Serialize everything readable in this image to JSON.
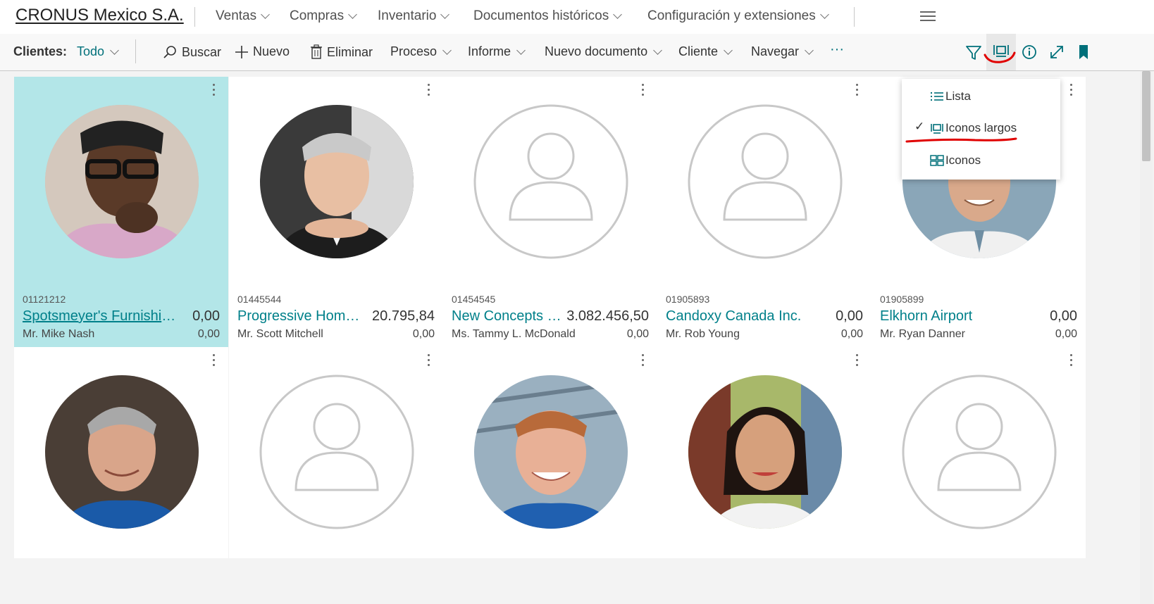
{
  "app": {
    "company": "CRONUS Mexico S.A.",
    "nav": [
      "Ventas",
      "Compras",
      "Inventario",
      "Documentos históricos",
      "Configuración y extensiones"
    ]
  },
  "actionbar": {
    "page_label": "Clientes:",
    "filter_value": "Todo",
    "buscar": "Buscar",
    "nuevo": "Nuevo",
    "eliminar": "Eliminar",
    "proceso": "Proceso",
    "informe": "Informe",
    "nuevo_documento": "Nuevo documento",
    "cliente": "Cliente",
    "navegar": "Navegar",
    "more": "···"
  },
  "view_menu": {
    "items": [
      "Lista",
      "Iconos largos",
      "Iconos"
    ],
    "selected": "Iconos largos"
  },
  "cards": [
    {
      "no": "01121212",
      "name": "Spotsmeyer's Furnishings",
      "balance": "0,00",
      "contact": "Mr. Mike Nash",
      "balance_due": "0,00",
      "photo": "man-glasses-photo"
    },
    {
      "no": "01445544",
      "name": "Progressive Home ...",
      "balance": "20.795,84",
      "contact": "Mr. Scott Mitchell",
      "balance_due": "0,00",
      "photo": "man-suit-photo"
    },
    {
      "no": "01454545",
      "name": "New Concepts F...",
      "balance": "3.082.456,50",
      "contact": "Ms. Tammy L. McDonald",
      "balance_due": "0,00",
      "photo": "placeholder"
    },
    {
      "no": "01905893",
      "name": "Candoxy Canada Inc.",
      "balance": "0,00",
      "contact": "Mr. Rob Young",
      "balance_due": "0,00",
      "photo": "placeholder"
    },
    {
      "no": "01905899",
      "name": "Elkhorn Airport",
      "balance": "0,00",
      "contact": "Mr. Ryan Danner",
      "balance_due": "0,00",
      "photo": "man-smiling-photo"
    },
    {
      "photo": "man-grey-hair-photo"
    },
    {
      "photo": "placeholder"
    },
    {
      "photo": "man-red-hair-photo"
    },
    {
      "photo": "woman-photo"
    },
    {
      "photo": "placeholder"
    }
  ],
  "colors": {
    "accent": "#00808a",
    "selected_card": "#b3e6e8",
    "annotation": "#e00000"
  }
}
